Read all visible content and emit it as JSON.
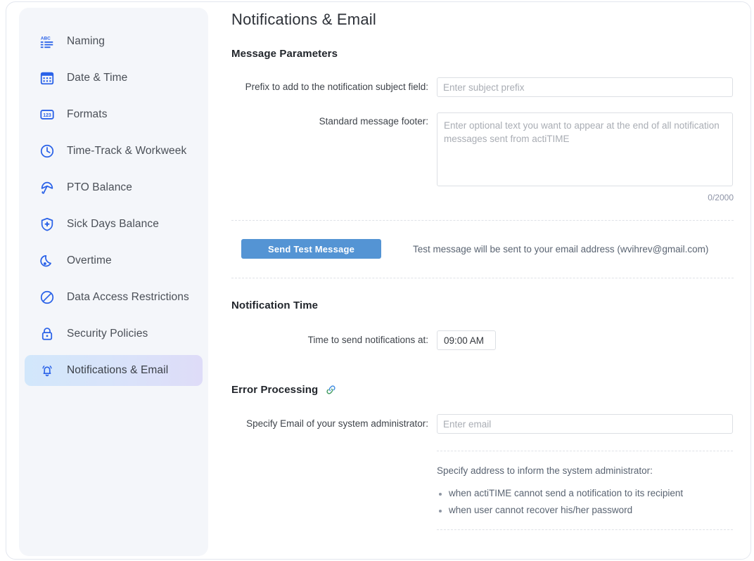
{
  "header": {
    "title": "Notifications & Email"
  },
  "sidebar": {
    "items": [
      {
        "label": "Naming",
        "icon": "abc-list-icon",
        "active": false
      },
      {
        "label": "Date & Time",
        "icon": "calendar-icon",
        "active": false
      },
      {
        "label": "Formats",
        "icon": "numbers-123-icon",
        "active": false
      },
      {
        "label": "Time-Track & Workweek",
        "icon": "clock-icon",
        "active": false
      },
      {
        "label": "PTO Balance",
        "icon": "umbrella-icon",
        "active": false
      },
      {
        "label": "Sick Days Balance",
        "icon": "shield-plus-icon",
        "active": false
      },
      {
        "label": "Overtime",
        "icon": "moon-icon",
        "active": false
      },
      {
        "label": "Data Access Restrictions",
        "icon": "no-entry-icon",
        "active": false
      },
      {
        "label": "Security Policies",
        "icon": "lock-icon",
        "active": false
      },
      {
        "label": "Notifications & Email",
        "icon": "bell-icon",
        "active": true
      }
    ]
  },
  "message_parameters": {
    "section_title": "Message Parameters",
    "prefix_label": "Prefix to add to the notification subject field:",
    "prefix_value": "",
    "prefix_placeholder": "Enter subject prefix",
    "footer_label": "Standard message footer:",
    "footer_value": "",
    "footer_placeholder": "Enter optional text you want to appear at the end of all notification messages sent from actiTIME",
    "char_counter": "0/2000",
    "send_test_label": "Send Test Message",
    "test_hint": "Test message will be sent to your email address (wvihrev@gmail.com)"
  },
  "notification_time": {
    "section_title": "Notification Time",
    "time_label": "Time to send notifications at:",
    "time_value": "09:00 AM"
  },
  "error_processing": {
    "section_title": "Error Processing",
    "link_icon": "chain-link-icon",
    "admin_email_label": "Specify Email of your system administrator:",
    "admin_email_value": "",
    "admin_email_placeholder": "Enter email",
    "note": "Specify address to inform the system administrator:",
    "bullets": [
      "when actiTIME cannot send a notification to its recipient",
      "when user cannot recover his/her password"
    ]
  },
  "colors": {
    "accent": "#2a62e8",
    "button": "#5494d4",
    "active_gradient_start": "#d2e7fb",
    "active_gradient_end": "#dedcf8"
  }
}
